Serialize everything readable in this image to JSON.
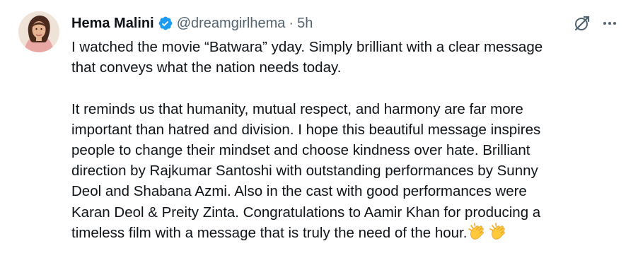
{
  "author": {
    "name": "Hema Malini",
    "handle": "@dreamgirlhema",
    "separator": "·",
    "time": "5h",
    "verified": true
  },
  "icons": {
    "verified": "verified-badge-icon",
    "grok": "grok-icon",
    "more": "more-options-icon",
    "clap": "clapping-hands-emoji"
  },
  "colors": {
    "text": "#0f1419",
    "secondary": "#536471",
    "verified": "#1d9bf0"
  },
  "tweet": {
    "paragraphs": [
      [
        "I watched the movie “Batwara” yday. Simply brilliant with a clear message",
        "that conveys what the nation needs today."
      ],
      [
        "It reminds us that humanity, mutual respect, and harmony are far more",
        "important than hatred and division. I hope this beautiful message inspires",
        "people to change their mindset and choose kindness over hate. Brilliant",
        "direction by Rajkumar Santoshi with outstanding performances by Sunny",
        "Deol and Shabana Azmi. Also in the cast with good performances were",
        "Karan Deol & Preity Zinta. Congratulations  to Aamir Khan for producing a",
        "timeless film with a message that is truly the need of the hour."
      ]
    ]
  }
}
